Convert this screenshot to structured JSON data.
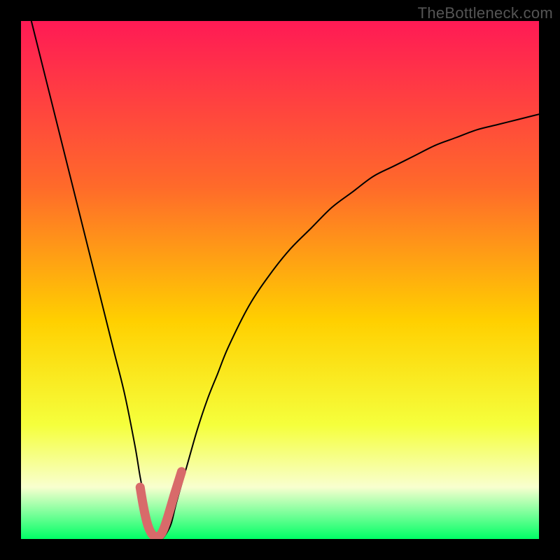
{
  "watermark": "TheBottleneck.com",
  "colors": {
    "frame": "#000000",
    "gradient_top": "#ff1a55",
    "gradient_upper": "#ff6a2a",
    "gradient_mid": "#ffd000",
    "gradient_lower": "#f5ff3c",
    "gradient_pale": "#f8ffcf",
    "gradient_bottom": "#00ff66",
    "curve": "#000000",
    "highlight": "#d86a6a"
  },
  "chart_data": {
    "type": "line",
    "title": "",
    "xlabel": "",
    "ylabel": "",
    "xlim": [
      0,
      100
    ],
    "ylim": [
      0,
      100
    ],
    "grid": false,
    "series": [
      {
        "name": "bottleneck-curve",
        "x": [
          2,
          4,
          6,
          8,
          10,
          12,
          14,
          16,
          18,
          20,
          22,
          23,
          24,
          25,
          26,
          27,
          28,
          29,
          30,
          32,
          34,
          36,
          38,
          40,
          44,
          48,
          52,
          56,
          60,
          64,
          68,
          72,
          76,
          80,
          84,
          88,
          92,
          96,
          100
        ],
        "y": [
          100,
          92,
          84,
          76,
          68,
          60,
          52,
          44,
          36,
          28,
          18,
          12,
          7,
          3,
          1,
          0,
          1,
          3,
          7,
          14,
          21,
          27,
          32,
          37,
          45,
          51,
          56,
          60,
          64,
          67,
          70,
          72,
          74,
          76,
          77.5,
          79,
          80,
          81,
          82
        ]
      },
      {
        "name": "sweet-spot-highlight",
        "x": [
          23.0,
          23.5,
          24.0,
          24.5,
          25.0,
          25.5,
          26.0,
          26.5,
          27.0,
          27.5,
          28.0,
          28.5,
          29.0,
          29.5,
          30.0,
          30.5,
          31.0
        ],
        "y": [
          10.0,
          7.0,
          4.5,
          2.6,
          1.4,
          0.7,
          0.4,
          0.5,
          0.9,
          1.8,
          3.2,
          4.8,
          6.5,
          8.2,
          9.8,
          11.4,
          13.0
        ]
      }
    ],
    "annotations": []
  }
}
